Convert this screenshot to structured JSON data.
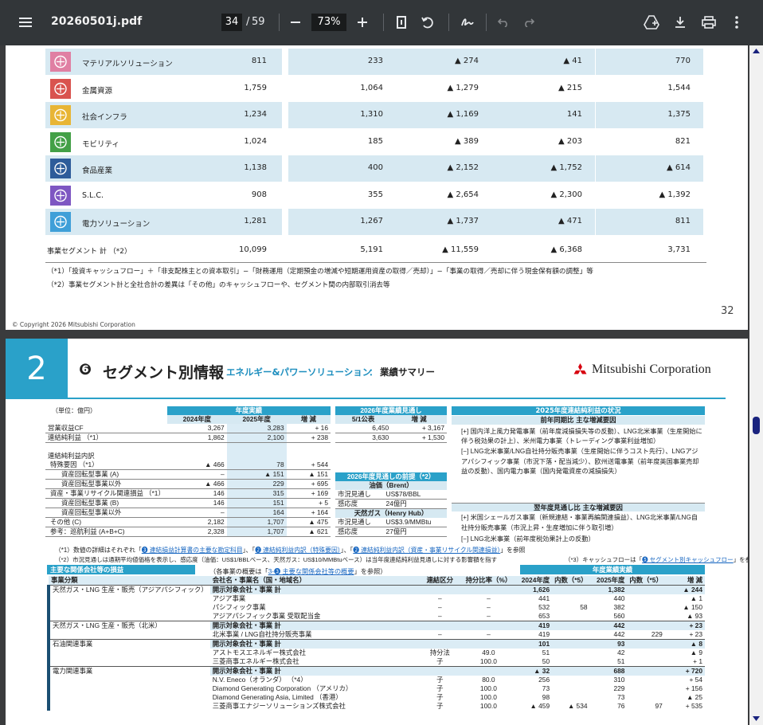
{
  "toolbar": {
    "menu_icon": "menu-icon",
    "file_name": "20260501j.pdf",
    "page_current": "34",
    "page_sep": "/",
    "page_total": "59",
    "zoom": "73%"
  },
  "page1": {
    "rows": [
      {
        "name": "マテリアルソリューション",
        "c1": "811",
        "c2": "233",
        "c3": "▲ 274",
        "c4": "▲ 41",
        "c5": "770",
        "icon_color": "#e07fa3"
      },
      {
        "name": "金属資源",
        "c1": "1,759",
        "c2": "1,064",
        "c3": "▲ 1,279",
        "c4": "▲ 215",
        "c5": "1,544",
        "icon_color": "#d9534f"
      },
      {
        "name": "社会インフラ",
        "c1": "1,234",
        "c2": "1,310",
        "c3": "▲ 1,169",
        "c4": "141",
        "c5": "1,375",
        "icon_color": "#e8b535"
      },
      {
        "name": "モビリティ",
        "c1": "1,024",
        "c2": "185",
        "c3": "▲ 389",
        "c4": "▲ 203",
        "c5": "821",
        "icon_color": "#43a047"
      },
      {
        "name": "食品産業",
        "c1": "1,138",
        "c2": "400",
        "c3": "▲ 2,152",
        "c4": "▲ 1,752",
        "c5": "▲ 614",
        "icon_color": "#2e5c9a"
      },
      {
        "name": "S.L.C.",
        "c1": "908",
        "c2": "355",
        "c3": "▲ 2,654",
        "c4": "▲ 2,300",
        "c5": "▲ 1,392",
        "icon_color": "#7e57c2"
      },
      {
        "name": "電力ソリューション",
        "c1": "1,281",
        "c2": "1,267",
        "c3": "▲ 1,737",
        "c4": "▲ 471",
        "c5": "811",
        "icon_color": "#3f9fd8"
      }
    ],
    "total": {
      "name": "事業セグメント 計 （*2）",
      "c1": "10,099",
      "c2": "5,191",
      "c3": "▲ 11,559",
      "c4": "▲ 6,368",
      "c5": "3,731"
    },
    "note1": "（*1）「投資キャッシュフロー」＋「非支配株主との資本取引」−「財務運用（定期預金の増減や短期運用資産の取得／売却）」−「事業の取得／売却に伴う現金保有額の調整」等",
    "note2": "（*2）事業セグメント計と全社合計の差異は「その他」のキャッシュフローや、セグメント間の内部取引消去等",
    "page_number": "32",
    "copyright": "© Copyright 2026 Mitsubishi Corporation"
  },
  "page2": {
    "chapter": "2",
    "title_num": "❻",
    "title": "セグメント別情報",
    "title_sub": "エネルギー&パワーソリューション",
    "title_colon": "：",
    "title_tail": "業績サマリー",
    "logo": "Mitsubishi Corporation",
    "unit": "（単位：億円）",
    "results_header": "年度実績",
    "col_2024": "2024年度",
    "col_2025": "2025年度",
    "col_diff": "増 減",
    "forecast_header": "2026年度業績見通し",
    "col_fc": "5/1公表",
    "col_fdiff": "増 減",
    "status_header": "2025年度連結純利益の状況",
    "status_sub": "前年同期比 主な増減要因",
    "main_rows": [
      {
        "label": "営業収益CF",
        "a": "3,267",
        "b": "3,283",
        "c": "+ 16",
        "f": "6,450",
        "g": "+ 3,167"
      },
      {
        "label": "連結純利益 （*1）",
        "a": "1,862",
        "b": "2,100",
        "c": "+ 238",
        "f": "3,630",
        "g": "+ 1,530"
      }
    ],
    "breakdown_title": "連結純利益内訳",
    "breakdown": [
      {
        "label": "特殊要因 （*1）",
        "a": "▲ 466",
        "b": "78",
        "c": "+ 544",
        "ind": 1
      },
      {
        "label": "資産回転型事業 (A)",
        "a": "–",
        "b": "▲ 151",
        "c": "▲ 151",
        "ind": 2
      },
      {
        "label": "資産回転型事業以外",
        "a": "▲ 466",
        "b": "229",
        "c": "+ 695",
        "ind": 2
      },
      {
        "label": "資産・事業リサイクル関連損益 （*1）",
        "a": "146",
        "b": "315",
        "c": "+ 169",
        "ind": 1
      },
      {
        "label": "資産回転型事業 (B)",
        "a": "146",
        "b": "151",
        "c": "+ 5",
        "ind": 2
      },
      {
        "label": "資産回転型事業以外",
        "a": "–",
        "b": "164",
        "c": "+ 164",
        "ind": 2
      },
      {
        "label": "その他 (C)",
        "a": "2,182",
        "b": "1,707",
        "c": "▲ 475",
        "ind": 0
      },
      {
        "label": "参考：巡航利益 (A+B+C)",
        "a": "2,328",
        "b": "1,707",
        "c": "▲ 621",
        "ind": 0
      }
    ],
    "premise_header": "2026年度見通しの前提（*2）",
    "oil_header": "油価（Brent）",
    "oil": [
      {
        "k": "市況見通し",
        "v": "US$78/BBL"
      },
      {
        "k": "感応度",
        "v": "24億円"
      }
    ],
    "gas_header": "天然ガス（Henry Hub）",
    "gas": [
      {
        "k": "市況見通し",
        "v": "US$3.9/MMBtu"
      },
      {
        "k": "感応度",
        "v": "27億円"
      }
    ],
    "status_plus": "[+] 国内洋上風力発電事業（前年度減損損失等の反動）、LNG北米事業（生産開始に伴う税効果の計上）、米州電力事業（トレーディング事業利益増加）",
    "status_minus": "[−] LNG北米事業/LNG自社持分販売事業（生産開始に伴うコスト先行）、LNGアジアパシフィック事業（市況下落・配当減少）、欧州送電事業（前年度英国事業売却益の反動）、国内電力事業（国内発電資産の減損損失）",
    "next_header": "翌年度見通し比 主な増減要因",
    "next_plus": "[+] 米国シェールガス事業（新規連結・事業再編関連損益）、LNG北米事業/LNG自社持分販売事業（市況上昇・生産増加に伴う取引増）",
    "next_minus": "[−] LNG北米事業（前年度税効果計上の反動）",
    "fn1_pre": "（*1）数値の詳細はそれぞれ「",
    "fn1_l1": "❸ 連結損益計算書の主要な勘定科目",
    "fn1_m1": "」、「",
    "fn1_l2": "❷ 連結純利益内訳（特殊要因）",
    "fn1_m2": "」、「",
    "fn1_l3": "❷ 連結純利益内訳（資産・事業リサイクル関連損益）",
    "fn1_post": "」を参照",
    "fn2": "（*2）市況見通しは通期平均値価格を表示し、感応度（油価：US$1/BBLベース、天然ガス：US$10/MMBtuベース）は当年度連結純利益見通しに対する影響額を指す",
    "fn3_pre": "（*3）キャッシュフローは「",
    "fn3_link": "❺ セグメント別キャッシュフロー",
    "fn3_post": "」を参照",
    "assoc_header": "主要な関係会社等の損益",
    "assoc_note_pre": "（各事業の概要は「",
    "assoc_note_link": "3-❸ 主要な関係会社等の概要",
    "assoc_note_post": "」を参照）",
    "annual_header": "年度業績実績",
    "cols": {
      "cat": "事業分類",
      "co": "会社名・事業名（国・地域名）",
      "kubun": "連結区分",
      "ratio": "持分比率（%）",
      "y24": "2024年度",
      "in24": "内数（*5）",
      "y25": "2025年度",
      "in25": "内数（*5）",
      "diff": "増 減"
    },
    "groups": [
      {
        "cat": "天然ガス・LNG 生産・販売（アジアパシフィック）",
        "rows": [
          {
            "co": "開示対象会社・事業 計",
            "k": "",
            "p": "",
            "y24": "1,626",
            "i24": "",
            "y25": "1,382",
            "i25": "",
            "d": "▲ 244",
            "bold": true
          },
          {
            "co": "アジア事業",
            "k": "–",
            "p": "–",
            "y24": "441",
            "i24": "",
            "y25": "440",
            "i25": "",
            "d": "▲ 1"
          },
          {
            "co": "パシフィック事業",
            "k": "–",
            "p": "–",
            "y24": "532",
            "i24": "58",
            "y25": "382",
            "i25": "",
            "d": "▲ 150"
          },
          {
            "co": "アジアパシフィック事業 受取配当金",
            "k": "–",
            "p": "–",
            "y24": "653",
            "i24": "",
            "y25": "560",
            "i25": "",
            "d": "▲ 93"
          }
        ]
      },
      {
        "cat": "天然ガス・LNG 生産・販売（北米）",
        "rows": [
          {
            "co": "開示対象会社・事業 計",
            "k": "",
            "p": "",
            "y24": "419",
            "i24": "",
            "y25": "442",
            "i25": "",
            "d": "+ 23",
            "bold": true
          },
          {
            "co": "北米事業 / LNG自社持分販売事業",
            "k": "–",
            "p": "–",
            "y24": "419",
            "i24": "",
            "y25": "442",
            "i25": "229",
            "d": "+ 23"
          }
        ]
      },
      {
        "cat": "石油関連事業",
        "rows": [
          {
            "co": "開示対象会社・事業 計",
            "k": "",
            "p": "",
            "y24": "101",
            "i24": "",
            "y25": "93",
            "i25": "",
            "d": "▲ 8",
            "bold": true
          },
          {
            "co": "アストモスエネルギー株式会社",
            "k": "持分法",
            "p": "49.0",
            "y24": "51",
            "i24": "",
            "y25": "42",
            "i25": "",
            "d": "▲ 9"
          },
          {
            "co": "三菱商事エネルギー株式会社",
            "k": "子",
            "p": "100.0",
            "y24": "50",
            "i24": "",
            "y25": "51",
            "i25": "",
            "d": "+ 1"
          }
        ]
      },
      {
        "cat": "電力関連事業",
        "rows": [
          {
            "co": "開示対象会社・事業 計",
            "k": "",
            "p": "",
            "y24": "▲ 32",
            "i24": "",
            "y25": "688",
            "i25": "",
            "d": "+ 720",
            "bold": true
          },
          {
            "co": "N.V. Eneco（オランダ） （*4）",
            "k": "子",
            "p": "80.0",
            "y24": "256",
            "i24": "",
            "y25": "310",
            "i25": "",
            "d": "+ 54"
          },
          {
            "co": "Diamond Generating Corporation （アメリカ）",
            "k": "子",
            "p": "100.0",
            "y24": "73",
            "i24": "",
            "y25": "229",
            "i25": "",
            "d": "+ 156"
          },
          {
            "co": "Diamond Generating Asia, Limited （香港）",
            "k": "子",
            "p": "100.0",
            "y24": "98",
            "i24": "",
            "y25": "73",
            "i25": "",
            "d": "▲ 25"
          },
          {
            "co": "三菱商事エナジーソリューションズ株式会社",
            "k": "子",
            "p": "100.0",
            "y24": "▲ 459",
            "i24": "▲ 534",
            "y25": "76",
            "i25": "97",
            "d": "+ 535"
          }
        ]
      }
    ]
  }
}
